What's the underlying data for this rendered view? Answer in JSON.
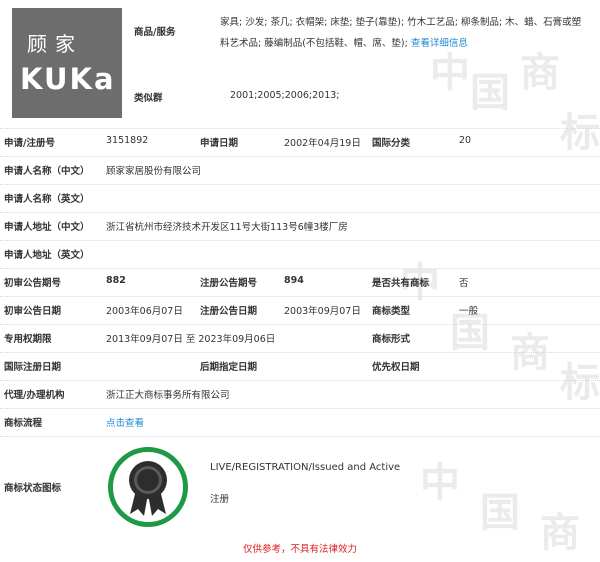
{
  "logo": {
    "cn_text": "顾家",
    "en_text": "KUKa"
  },
  "goods": {
    "label": "商品/服务",
    "text": "家具; 沙发; 茶几; 衣帽架; 床垫; 垫子(靠垫); 竹木工艺品; 柳条制品; 木、蜡、石膏或塑料艺术品; 藤编制品(不包括鞋、帽、席、垫);",
    "detail_link": "查看详细信息"
  },
  "similar_group": {
    "label": "类似群",
    "value": "2001;2005;2006;2013;"
  },
  "fields": {
    "reg_no_label": "申请/注册号",
    "reg_no": "3151892",
    "apply_date_label": "申请日期",
    "apply_date": "2002年04月19日",
    "intl_class_label": "国际分类",
    "intl_class": "20",
    "applicant_cn_label": "申请人名称（中文）",
    "applicant_cn": "顾家家居股份有限公司",
    "applicant_en_label": "申请人名称（英文）",
    "address_cn_label": "申请人地址（中文）",
    "address_cn": "浙江省杭州市经济技术开发区11号大街113号6幢3楼厂房",
    "address_en_label": "申请人地址（英文）",
    "prelim_no_label": "初审公告期号",
    "prelim_no": "882",
    "reg_pub_no_label": "注册公告期号",
    "reg_pub_no": "894",
    "shared_label": "是否共有商标",
    "shared": "否",
    "prelim_date_label": "初审公告日期",
    "prelim_date": "2003年06月07日",
    "reg_pub_date_label": "注册公告日期",
    "reg_pub_date": "2003年09月07日",
    "tm_type_label": "商标类型",
    "tm_type": "一般",
    "exclusive_label": "专用权期限",
    "exclusive": "2013年09月07日 至 2023年09月06日",
    "tm_form_label": "商标形式",
    "intl_reg_date_label": "国际注册日期",
    "later_date_label": "后期指定日期",
    "priority_label": "优先权日期",
    "agent_label": "代理/办理机构",
    "agent": "浙江正大商标事务所有限公司",
    "flow_label": "商标流程",
    "flow_link": "点击查看",
    "status_label": "商标状态图标",
    "status_en": "LIVE/REGISTRATION/Issued and Active",
    "status_cn": "注册"
  },
  "notice": "仅供参考，不具有法律效力",
  "colors": {
    "link": "#1e88d2",
    "seal": "#1e9a46",
    "notice": "#e02020",
    "logo_bg": "#6d6d6d"
  }
}
